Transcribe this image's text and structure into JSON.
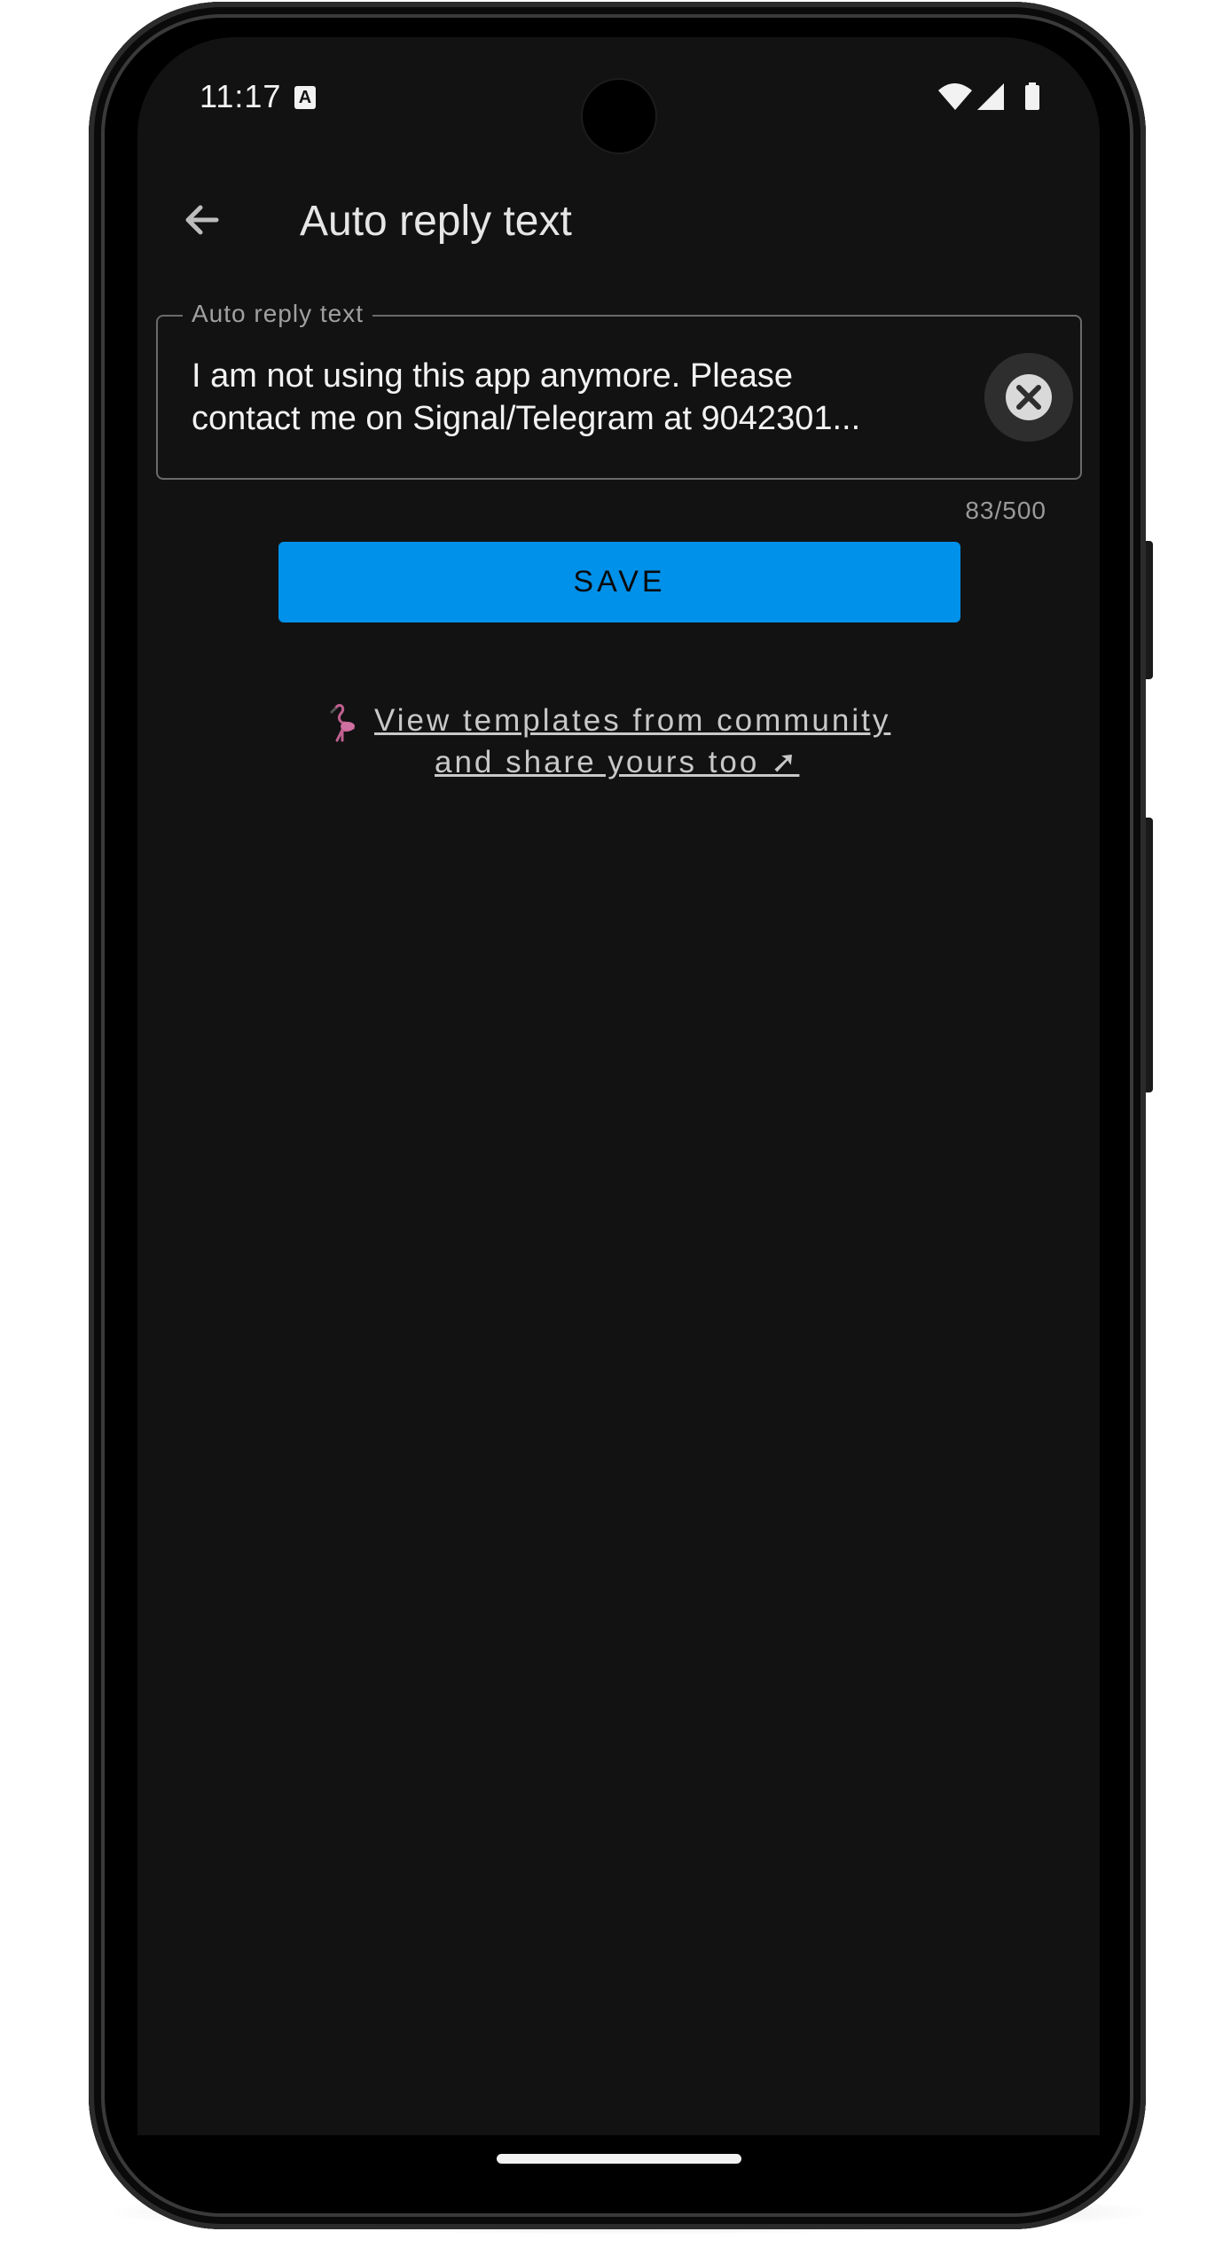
{
  "status_bar": {
    "time": "11:17",
    "keyboard_indicator": "A",
    "icons": [
      "wifi-icon",
      "cellular-signal-icon",
      "battery-icon"
    ]
  },
  "app_bar": {
    "back_icon": "arrow-left-icon",
    "title": "Auto reply text"
  },
  "reply_field": {
    "label": "Auto reply text",
    "value": "I am not using this app anymore. Please\ncontact me on Signal/Telegram at 9042301...",
    "clear_icon": "close-circle-icon",
    "char_count": "83/500"
  },
  "save_button": {
    "label": "SAVE"
  },
  "community_link": {
    "icon": "flamingo-icon",
    "line1": "View templates from community",
    "line2": "and share yours too ➚"
  },
  "colors": {
    "background": "#121212",
    "accent": "#0091ea",
    "text_primary": "#f2f2f2",
    "text_secondary": "#a0a0a0"
  }
}
